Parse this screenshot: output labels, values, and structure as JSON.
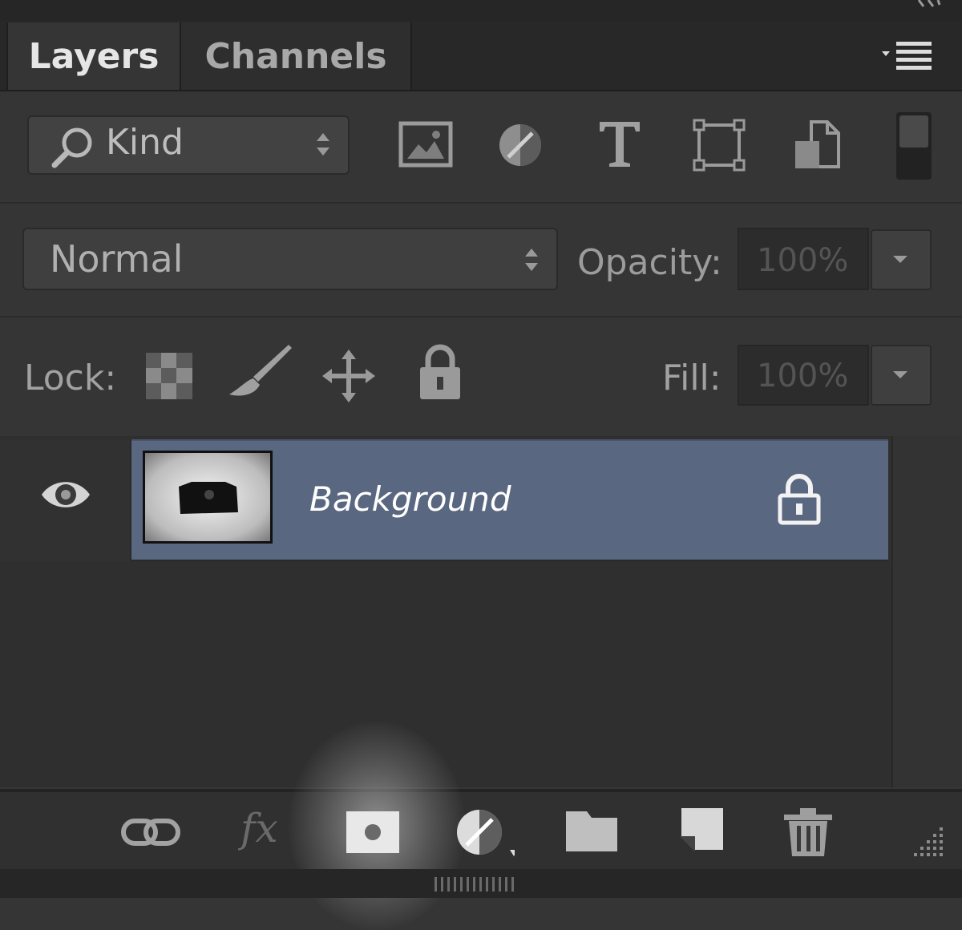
{
  "tabs": [
    {
      "label": "Layers",
      "active": true
    },
    {
      "label": "Channels",
      "active": false
    }
  ],
  "filter": {
    "kind_label": "Kind",
    "icons": [
      "image-filter-icon",
      "adjustment-filter-icon",
      "type-filter-icon",
      "shape-filter-icon",
      "smart-object-filter-icon"
    ]
  },
  "blend": {
    "mode": "Normal",
    "opacity_label": "Opacity:",
    "opacity_value": "100%"
  },
  "lock": {
    "label": "Lock:",
    "icons": [
      "lock-transparent-pixels-icon",
      "lock-image-pixels-icon",
      "lock-position-icon",
      "lock-all-icon"
    ],
    "fill_label": "Fill:",
    "fill_value": "100%"
  },
  "layers": [
    {
      "name": "Background",
      "visible": true,
      "locked": true,
      "selected": true
    }
  ],
  "bottom_icons": [
    "link-layers-icon",
    "fx-icon",
    "add-mask-icon",
    "adjustment-layer-icon",
    "new-group-icon",
    "new-layer-icon",
    "delete-layer-icon"
  ],
  "colors": {
    "panel_bg": "#353535",
    "selected_row": "#5a6780",
    "text": "#e6e6e6"
  }
}
